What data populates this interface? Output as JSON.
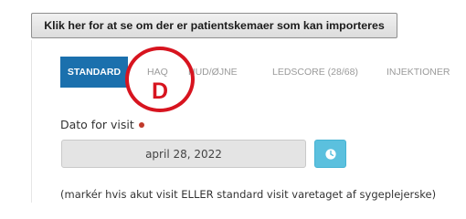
{
  "import_button": {
    "label": "Klik her for at se om der er patientskemaer som kan importeres"
  },
  "tabs": [
    {
      "label": "STANDARD",
      "active": true
    },
    {
      "label": "HAQ",
      "active": false
    },
    {
      "label": "HUD/ØJNE",
      "active": false
    },
    {
      "label": "LEDSCORE (28/68)",
      "active": false
    },
    {
      "label": "INJEKTIONER",
      "active": false
    }
  ],
  "annotation": {
    "letter": "D",
    "color": "#d7141f"
  },
  "visit": {
    "label": "Dato for visit",
    "date_value": "april 28, 2022",
    "clock_icon": "clock-icon"
  },
  "note": "(markér hvis akut visit ELLER standard visit varetaget af sygeplejerske)",
  "colors": {
    "active_tab": "#1b70ad",
    "clock_button": "#5bc0de",
    "required_dot": "#c0392b"
  }
}
